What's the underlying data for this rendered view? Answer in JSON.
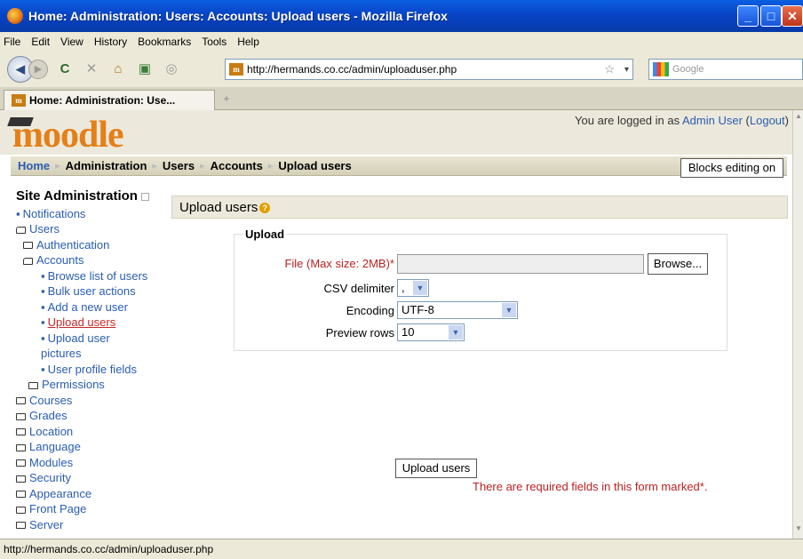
{
  "window": {
    "title": "Home: Administration: Users: Accounts: Upload users - Mozilla Firefox"
  },
  "menu": [
    "File",
    "Edit",
    "View",
    "History",
    "Bookmarks",
    "Tools",
    "Help"
  ],
  "nav": {
    "url": "http://hermands.co.cc/admin/uploaduser.php",
    "search_placeholder": "Google"
  },
  "tab": {
    "title": "Home: Administration: Use..."
  },
  "header": {
    "logo": "moodle",
    "login_prefix": "You are logged in as ",
    "login_user": "Admin User",
    "logout": "Logout"
  },
  "breadcrumb": {
    "home": "Home",
    "items": [
      "Administration",
      "Users",
      "Accounts",
      "Upload users"
    ]
  },
  "blocks_button": "Blocks editing on",
  "sidebar": {
    "title": "Site Administration",
    "items": [
      {
        "label": "Notifications"
      },
      {
        "label": "Users"
      },
      {
        "label": "Authentication"
      },
      {
        "label": "Accounts"
      },
      {
        "label": "Browse list of users"
      },
      {
        "label": "Bulk user actions"
      },
      {
        "label": "Add a new user"
      },
      {
        "label": "Upload users"
      },
      {
        "label": "Upload user"
      },
      {
        "label": "pictures"
      },
      {
        "label": "User profile fields"
      },
      {
        "label": "Permissions"
      },
      {
        "label": "Courses"
      },
      {
        "label": "Grades"
      },
      {
        "label": "Location"
      },
      {
        "label": "Language"
      },
      {
        "label": "Modules"
      },
      {
        "label": "Security"
      },
      {
        "label": "Appearance"
      },
      {
        "label": "Front Page"
      },
      {
        "label": "Server"
      }
    ]
  },
  "main": {
    "heading": "Upload users",
    "legend": "Upload",
    "file_label": "File (Max size: 2MB)*",
    "browse": "Browse...",
    "csv_label": "CSV delimiter",
    "csv_value": ",",
    "encoding_label": "Encoding",
    "encoding_value": "UTF-8",
    "preview_label": "Preview rows",
    "preview_value": "10",
    "submit": "Upload users",
    "required_note": "There are required fields in this form marked*."
  },
  "status": "http://hermands.co.cc/admin/uploaduser.php"
}
